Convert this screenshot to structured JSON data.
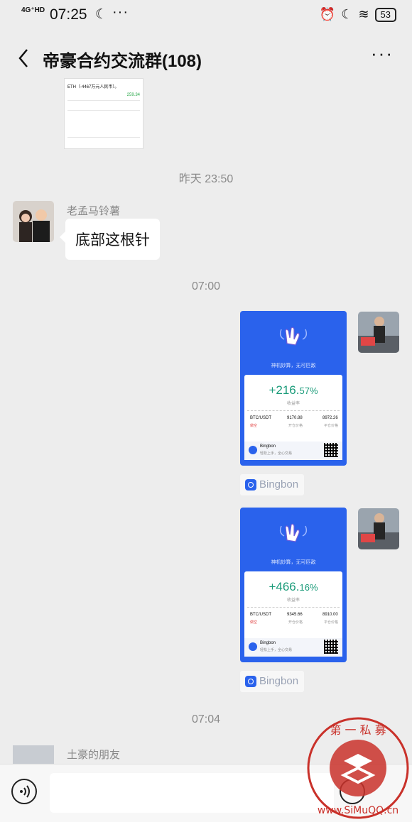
{
  "status_bar": {
    "network": "4G⁺HD",
    "time": "07:25",
    "battery": "53"
  },
  "nav": {
    "title": "帝豪合约交流群(108)"
  },
  "top_thumbnail": {
    "headline": "ETH（-4467万元人民币）。",
    "green_value": "259.34"
  },
  "timestamps": {
    "t1": "昨天 23:50",
    "t2": "07:00",
    "t3": "07:04"
  },
  "message_1": {
    "sender": "老孟马铃薯",
    "text": "底部这根针"
  },
  "cards": [
    {
      "slogan": "神机妙算，无可匹敌",
      "pct_main": "+216.",
      "pct_dec": "57%",
      "pct_label": "收益率",
      "pair": "BTC/USDT",
      "price_open": "9170.88",
      "price_close": "8972.26",
      "tag": "做空",
      "open_label": "开仓价格",
      "close_label": "平仓价格",
      "brand": "Bingbon",
      "brand_tag": "轻松上手，全心交易",
      "source": "Bingbon"
    },
    {
      "slogan": "神机妙算，无可匹敌",
      "pct_main": "+466.",
      "pct_dec": "16%",
      "pct_label": "收益率",
      "pair": "BTC/USDT",
      "price_open": "9345.66",
      "price_close": "8910.00",
      "tag": "做空",
      "open_label": "开仓价格",
      "close_label": "平仓价格",
      "brand": "Bingbon",
      "brand_tag": "轻松上手，全心交易",
      "source": "Bingbon"
    }
  ],
  "message_last": {
    "sender": "土豪的朋友"
  },
  "watermark": {
    "text": "第一私募 www.SiMuQQ.cn"
  }
}
